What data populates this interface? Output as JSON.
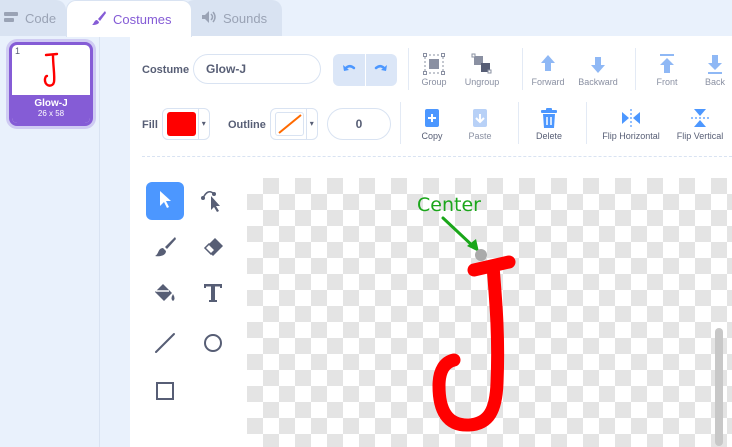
{
  "tabs": [
    {
      "label": "Code",
      "icon": "code-blocks-icon"
    },
    {
      "label": "Costumes",
      "icon": "paintbrush-icon"
    },
    {
      "label": "Sounds",
      "icon": "speaker-icon"
    }
  ],
  "costume_list": {
    "items": [
      {
        "number": "1",
        "name": "Glow-J",
        "size": "26 x 58"
      }
    ]
  },
  "toolbar": {
    "costume_label": "Costume",
    "costume_name": "Glow-J",
    "group_label": "Group",
    "ungroup_label": "Ungroup",
    "forward_label": "Forward",
    "backward_label": "Backward",
    "front_label": "Front",
    "back_label": "Back",
    "fill_label": "Fill",
    "fill_color": "#ff0000",
    "outline_label": "Outline",
    "outline_width": "0",
    "copy_label": "Copy",
    "paste_label": "Paste",
    "delete_label": "Delete",
    "flip_horizontal_label": "Flip Horizontal",
    "flip_vertical_label": "Flip Vertical"
  },
  "paint_tools": [
    {
      "name": "select",
      "icon": "arrow-select-icon",
      "selected": true
    },
    {
      "name": "reshape",
      "icon": "reshape-icon"
    },
    {
      "name": "brush",
      "icon": "brush-icon"
    },
    {
      "name": "eraser",
      "icon": "eraser-icon"
    },
    {
      "name": "fill",
      "icon": "fill-bucket-icon"
    },
    {
      "name": "text",
      "icon": "text-icon"
    },
    {
      "name": "line",
      "icon": "line-icon"
    },
    {
      "name": "circle",
      "icon": "circle-icon"
    },
    {
      "name": "rectangle",
      "icon": "rectangle-icon"
    }
  ],
  "canvas": {
    "annotation_text": "Center",
    "annotation_color": "#1aa61a",
    "letter_color": "#ff0000"
  },
  "colors": {
    "accent": "#855cd6",
    "tool_selected": "#4c97ff",
    "icon_blue": "#4c97ff"
  }
}
